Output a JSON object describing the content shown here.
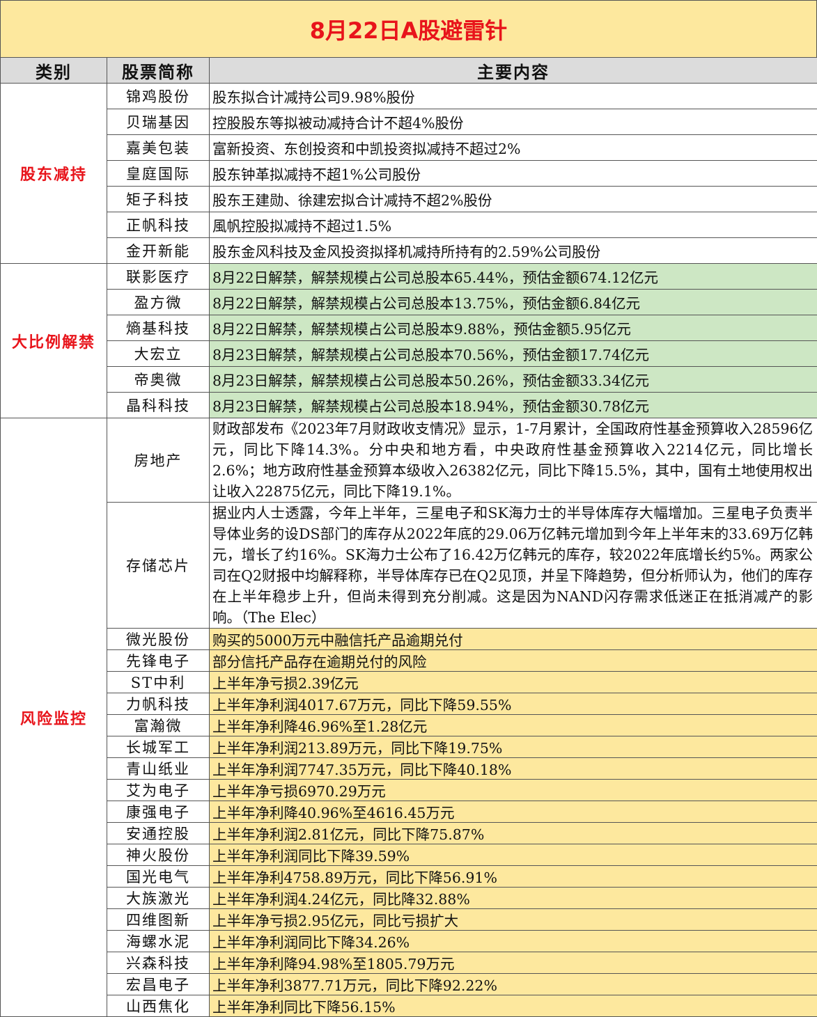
{
  "title": "8月22日A股避雷针",
  "headers": {
    "category": "类别",
    "stock": "股票简称",
    "content": "主要内容"
  },
  "sections": {
    "reduction": {
      "category": "股东减持",
      "rows": [
        {
          "stock": "锦鸡股份",
          "content": "股东拟合计减持公司9.98%股份"
        },
        {
          "stock": "贝瑞基因",
          "content": "控股股东等拟被动减持合计不超4%股份"
        },
        {
          "stock": "嘉美包装",
          "content": "富新投资、东创投资和中凯投资拟减持不超过2%"
        },
        {
          "stock": "皇庭国际",
          "content": "股东钟革拟减持不超1%公司股份"
        },
        {
          "stock": "矩子科技",
          "content": "股东王建勋、徐建宏拟合计减持不超2%股份"
        },
        {
          "stock": "正帆科技",
          "content": "風帆控股拟减持不超过1.5%"
        },
        {
          "stock": "金开新能",
          "content": "股东金风科技及金风投资拟择机减持所持有的2.59%公司股份"
        }
      ]
    },
    "unlock": {
      "category": "大比例解禁",
      "rows": [
        {
          "stock": "联影医疗",
          "content": "8月22日解禁，解禁规模占公司总股本65.44%，预估金额674.12亿元"
        },
        {
          "stock": "盈方微",
          "content": "8月22日解禁，解禁规模占公司总股本13.75%，预估金额6.84亿元"
        },
        {
          "stock": "熵基科技",
          "content": "8月22日解禁，解禁规模占公司总股本9.88%，预估金额5.95亿元"
        },
        {
          "stock": "大宏立",
          "content": "8月23日解禁，解禁规模占公司总股本70.56%，预估金额17.74亿元"
        },
        {
          "stock": "帝奥微",
          "content": "8月23日解禁，解禁规模占公司总股本50.26%，预估金额33.34亿元"
        },
        {
          "stock": "晶科科技",
          "content": "8月23日解禁，解禁规模占公司总股本18.94%，预估金额30.78亿元"
        }
      ]
    },
    "risk": {
      "category": "风险监控",
      "long_rows": [
        {
          "stock": "房地产",
          "content": "财政部发布《2023年7月财政收支情况》显示，1-7月累计，全国政府性基金预算收入28596亿元，同比下降14.3%。分中央和地方看，中央政府性基金预算收入2214亿元，同比增长2.6%；地方政府性基金预算本级收入26382亿元，同比下降15.5%，其中，国有土地使用权出让收入22875亿元，同比下降19.1%。"
        },
        {
          "stock": "存储芯片",
          "content": "据业内人士透露，今年上半年，三星电子和SK海力士的半导体库存大幅增加。三星电子负责半导体业务的设DS部门的库存从2022年底的29.06万亿韩元增加到今年上半年末的33.69万亿韩元，增长了约16%。SK海力士公布了16.42万亿韩元的库存，较2022年底增长约5%。两家公司在Q2财报中均解释称，半导体库存已在Q2见顶，并呈下降趋势，但分析师认为，他们的库存在上半年稳步上升，但尚未得到充分削减。这是因为NAND闪存需求低迷正在抵消减产的影响。（The Elec）"
        }
      ],
      "rows": [
        {
          "stock": "微光股份",
          "content": "购买的5000万元中融信托产品逾期兑付"
        },
        {
          "stock": "先锋电子",
          "content": "部分信托产品存在逾期兑付的风险"
        },
        {
          "stock": "ST中利",
          "content": "上半年净亏损2.39亿元"
        },
        {
          "stock": "力帆科技",
          "content": "上半年净利润4017.67万元，同比下降59.55%"
        },
        {
          "stock": "富瀚微",
          "content": "上半年净利降46.96%至1.28亿元"
        },
        {
          "stock": "长城军工",
          "content": "上半年净利润213.89万元，同比下降19.75%"
        },
        {
          "stock": "青山纸业",
          "content": "上半年净利润7747.35万元，同比下降40.18%"
        },
        {
          "stock": "艾为电子",
          "content": "上半年净亏损6970.29万元"
        },
        {
          "stock": "康强电子",
          "content": "上半年净利降40.96%至4616.45万元"
        },
        {
          "stock": "安通控股",
          "content": "上半年净利润2.81亿元，同比下降75.87%"
        },
        {
          "stock": "神火股份",
          "content": "上半年净利润同比下降39.59%"
        },
        {
          "stock": "国光电气",
          "content": "上半年净利4758.89万元，同比下降56.91%"
        },
        {
          "stock": "大族激光",
          "content": "上半年净利润4.24亿元，同比降32.88%"
        },
        {
          "stock": "四维图新",
          "content": "上半年净亏损2.95亿元，同比亏损扩大"
        },
        {
          "stock": "海螺水泥",
          "content": "上半年净利润同比下降34.26%"
        },
        {
          "stock": "兴森科技",
          "content": "上半年净利降94.98%至1805.79万元"
        },
        {
          "stock": "宏昌电子",
          "content": "上半年净利3877.71万元，同比下降92.22%"
        },
        {
          "stock": "山西焦化",
          "content": "上半年净利同比下降56.15%"
        }
      ]
    }
  }
}
